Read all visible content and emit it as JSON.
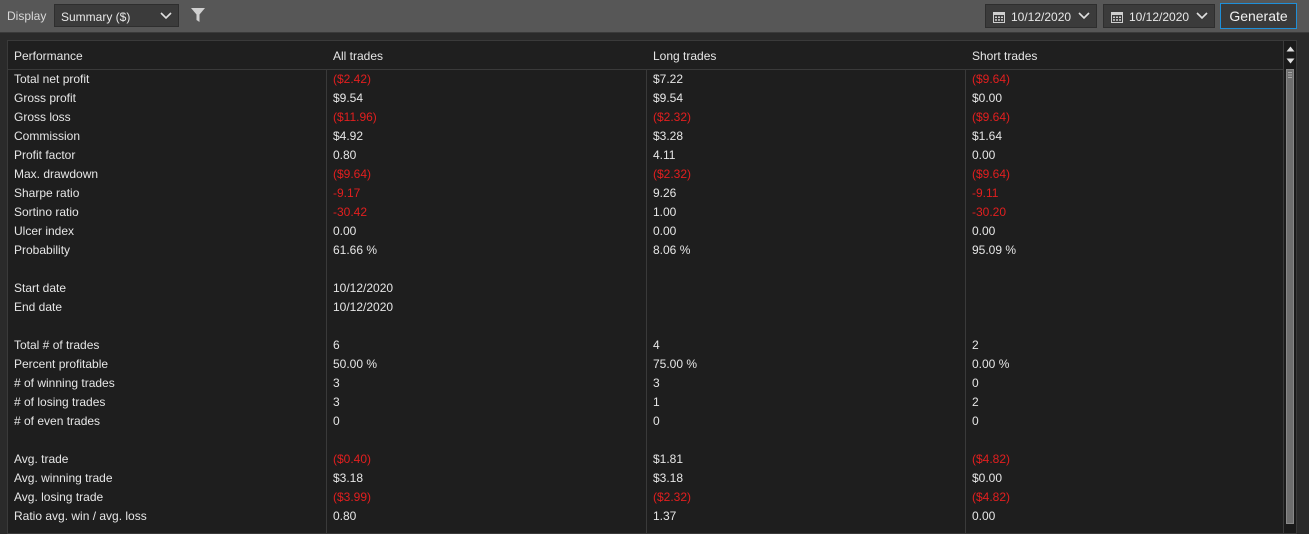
{
  "toolbar": {
    "display_label": "Display",
    "display_value": "Summary ($)",
    "date_from": "10/12/2020",
    "date_to": "10/12/2020",
    "generate_label": "Generate",
    "icons": {
      "filter": "filter-icon",
      "calendar": "calendar-icon",
      "dropdown": "chevron-down-icon"
    }
  },
  "colors": {
    "negative": "#e21f1f",
    "accent": "#1f8fd8",
    "background": "#1e1e1e",
    "toolbar": "#575757"
  },
  "table": {
    "headers": [
      "Performance",
      "All trades",
      "Long trades",
      "Short trades"
    ],
    "rows": [
      {
        "label": "Total net profit",
        "all": "($2.42)",
        "long": "$7.22",
        "short": "($9.64)"
      },
      {
        "label": "Gross profit",
        "all": "$9.54",
        "long": "$9.54",
        "short": "$0.00"
      },
      {
        "label": "Gross loss",
        "all": "($11.96)",
        "long": "($2.32)",
        "short": "($9.64)"
      },
      {
        "label": "Commission",
        "all": "$4.92",
        "long": "$3.28",
        "short": "$1.64"
      },
      {
        "label": "Profit factor",
        "all": "0.80",
        "long": "4.11",
        "short": "0.00"
      },
      {
        "label": "Max. drawdown",
        "all": "($9.64)",
        "long": "($2.32)",
        "short": "($9.64)"
      },
      {
        "label": "Sharpe ratio",
        "all": "-9.17",
        "long": "9.26",
        "short": "-9.11"
      },
      {
        "label": "Sortino ratio",
        "all": "-30.42",
        "long": "1.00",
        "short": "-30.20"
      },
      {
        "label": "Ulcer index",
        "all": "0.00",
        "long": "0.00",
        "short": "0.00"
      },
      {
        "label": "Probability",
        "all": "61.66 %",
        "long": "8.06 %",
        "short": "95.09 %"
      },
      {
        "label": "",
        "all": "",
        "long": "",
        "short": ""
      },
      {
        "label": "Start date",
        "all": "10/12/2020",
        "long": "",
        "short": ""
      },
      {
        "label": "End date",
        "all": "10/12/2020",
        "long": "",
        "short": ""
      },
      {
        "label": "",
        "all": "",
        "long": "",
        "short": ""
      },
      {
        "label": "Total # of trades",
        "all": "6",
        "long": "4",
        "short": "2"
      },
      {
        "label": "Percent profitable",
        "all": "50.00 %",
        "long": "75.00 %",
        "short": "0.00 %"
      },
      {
        "label": "# of winning trades",
        "all": "3",
        "long": "3",
        "short": "0"
      },
      {
        "label": "# of losing trades",
        "all": "3",
        "long": "1",
        "short": "2"
      },
      {
        "label": "# of even trades",
        "all": "0",
        "long": "0",
        "short": "0"
      },
      {
        "label": "",
        "all": "",
        "long": "",
        "short": ""
      },
      {
        "label": "Avg. trade",
        "all": "($0.40)",
        "long": "$1.81",
        "short": "($4.82)"
      },
      {
        "label": "Avg. winning trade",
        "all": "$3.18",
        "long": "$3.18",
        "short": "$0.00"
      },
      {
        "label": "Avg. losing trade",
        "all": "($3.99)",
        "long": "($2.32)",
        "short": "($4.82)"
      },
      {
        "label": "Ratio avg. win / avg. loss",
        "all": "0.80",
        "long": "1.37",
        "short": "0.00"
      }
    ]
  }
}
